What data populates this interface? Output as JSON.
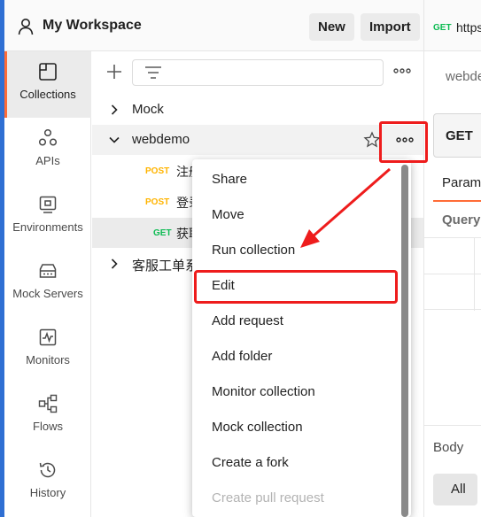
{
  "header": {
    "workspace_title": "My Workspace",
    "new_label": "New",
    "import_label": "Import"
  },
  "sidebar": {
    "items": [
      {
        "label": "Collections",
        "icon": "collections-icon"
      },
      {
        "label": "APIs",
        "icon": "apis-icon"
      },
      {
        "label": "Environments",
        "icon": "environments-icon"
      },
      {
        "label": "Mock Servers",
        "icon": "mock-servers-icon"
      },
      {
        "label": "Monitors",
        "icon": "monitors-icon"
      },
      {
        "label": "Flows",
        "icon": "flows-icon"
      },
      {
        "label": "History",
        "icon": "history-icon"
      }
    ]
  },
  "tree": {
    "collections": [
      {
        "label": "Mock",
        "expanded": false
      },
      {
        "label": "webdemo",
        "expanded": true,
        "requests": [
          {
            "method": "POST",
            "name": "注册"
          },
          {
            "method": "POST",
            "name": "登录"
          },
          {
            "method": "GET",
            "name": "获取"
          }
        ]
      },
      {
        "label": "客服工单系统",
        "expanded": false
      }
    ]
  },
  "menu": {
    "items": [
      {
        "label": "Share"
      },
      {
        "label": "Move"
      },
      {
        "label": "Run collection"
      },
      {
        "label": "Edit"
      },
      {
        "label": "Add request"
      },
      {
        "label": "Add folder"
      },
      {
        "label": "Monitor collection"
      },
      {
        "label": "Mock collection"
      },
      {
        "label": "Create a fork"
      },
      {
        "label": "Create pull request",
        "disabled": true
      }
    ]
  },
  "request_pane": {
    "tab_method": "GET",
    "tab_url": "https",
    "request_name": "webdemo",
    "method": "GET",
    "params_tab": "Params",
    "query_label": "Query",
    "body_label": "Body",
    "all_label": "All"
  },
  "colors": {
    "accent": "#ff6c37",
    "get": "#0cbb52",
    "post": "#ffb400",
    "annotation": "#ee1c1c"
  }
}
